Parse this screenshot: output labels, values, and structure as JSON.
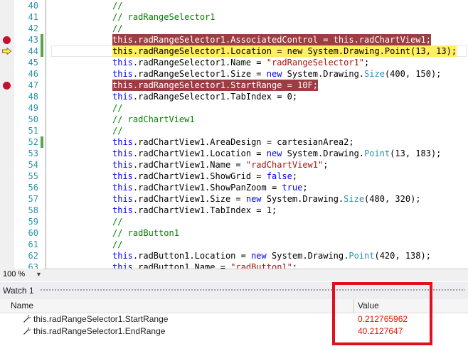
{
  "editor": {
    "lines": [
      {
        "num": "40",
        "bp": false,
        "arrow": false,
        "chg": false,
        "hl": "",
        "tokens": [
          {
            "t": "//",
            "c": "cmt"
          }
        ]
      },
      {
        "num": "41",
        "bp": false,
        "arrow": false,
        "chg": false,
        "hl": "",
        "tokens": [
          {
            "t": "// radRangeSelector1",
            "c": "cmt"
          }
        ]
      },
      {
        "num": "42",
        "bp": false,
        "arrow": false,
        "chg": false,
        "hl": "",
        "tokens": [
          {
            "t": "//",
            "c": "cmt"
          }
        ]
      },
      {
        "num": "43",
        "bp": true,
        "arrow": false,
        "chg": true,
        "hl": "red",
        "tokens": [
          {
            "t": "this.radRangeSelector1.AssociatedControl = this.radChartView1;",
            "c": ""
          }
        ]
      },
      {
        "num": "44",
        "bp": false,
        "arrow": true,
        "chg": true,
        "hl": "yellow",
        "tokens": [
          {
            "t": "this.radRangeSelector1.Location = new System.Drawing.Point(13, 13);",
            "c": ""
          }
        ]
      },
      {
        "num": "45",
        "bp": false,
        "arrow": false,
        "chg": false,
        "hl": "",
        "tokens": [
          {
            "t": "this",
            "c": "kw"
          },
          {
            "t": ".radRangeSelector1.Name = ",
            "c": ""
          },
          {
            "t": "\"radRangeSelector1\"",
            "c": "str"
          },
          {
            "t": ";",
            "c": ""
          }
        ]
      },
      {
        "num": "46",
        "bp": false,
        "arrow": false,
        "chg": false,
        "hl": "",
        "tokens": [
          {
            "t": "this",
            "c": "kw"
          },
          {
            "t": ".radRangeSelector1.Size = ",
            "c": ""
          },
          {
            "t": "new",
            "c": "kw"
          },
          {
            "t": " System.Drawing.",
            "c": ""
          },
          {
            "t": "Size",
            "c": "type"
          },
          {
            "t": "(400, 150);",
            "c": ""
          }
        ]
      },
      {
        "num": "47",
        "bp": true,
        "arrow": false,
        "chg": false,
        "hl": "red",
        "tokens": [
          {
            "t": "this.radRangeSelector1.StartRange = 10F;",
            "c": ""
          }
        ]
      },
      {
        "num": "48",
        "bp": false,
        "arrow": false,
        "chg": false,
        "hl": "",
        "tokens": [
          {
            "t": "this",
            "c": "kw"
          },
          {
            "t": ".radRangeSelector1.TabIndex = 0;",
            "c": ""
          }
        ]
      },
      {
        "num": "49",
        "bp": false,
        "arrow": false,
        "chg": false,
        "hl": "",
        "tokens": [
          {
            "t": "//",
            "c": "cmt"
          }
        ]
      },
      {
        "num": "50",
        "bp": false,
        "arrow": false,
        "chg": false,
        "hl": "",
        "tokens": [
          {
            "t": "// radChartView1",
            "c": "cmt"
          }
        ]
      },
      {
        "num": "51",
        "bp": false,
        "arrow": false,
        "chg": false,
        "hl": "",
        "tokens": [
          {
            "t": "//",
            "c": "cmt"
          }
        ]
      },
      {
        "num": "52",
        "bp": false,
        "arrow": false,
        "chg": true,
        "hl": "",
        "tokens": [
          {
            "t": "this",
            "c": "kw"
          },
          {
            "t": ".radChartView1.AreaDesign = cartesianArea2;",
            "c": ""
          }
        ]
      },
      {
        "num": "53",
        "bp": false,
        "arrow": false,
        "chg": false,
        "hl": "",
        "tokens": [
          {
            "t": "this",
            "c": "kw"
          },
          {
            "t": ".radChartView1.Location = ",
            "c": ""
          },
          {
            "t": "new",
            "c": "kw"
          },
          {
            "t": " System.Drawing.",
            "c": ""
          },
          {
            "t": "Point",
            "c": "type"
          },
          {
            "t": "(13, 183);",
            "c": ""
          }
        ]
      },
      {
        "num": "54",
        "bp": false,
        "arrow": false,
        "chg": false,
        "hl": "",
        "tokens": [
          {
            "t": "this",
            "c": "kw"
          },
          {
            "t": ".radChartView1.Name = ",
            "c": ""
          },
          {
            "t": "\"radChartView1\"",
            "c": "str"
          },
          {
            "t": ";",
            "c": ""
          }
        ]
      },
      {
        "num": "55",
        "bp": false,
        "arrow": false,
        "chg": false,
        "hl": "",
        "tokens": [
          {
            "t": "this",
            "c": "kw"
          },
          {
            "t": ".radChartView1.ShowGrid = ",
            "c": ""
          },
          {
            "t": "false",
            "c": "kw"
          },
          {
            "t": ";",
            "c": ""
          }
        ]
      },
      {
        "num": "56",
        "bp": false,
        "arrow": false,
        "chg": false,
        "hl": "",
        "tokens": [
          {
            "t": "this",
            "c": "kw"
          },
          {
            "t": ".radChartView1.ShowPanZoom = ",
            "c": ""
          },
          {
            "t": "true",
            "c": "kw"
          },
          {
            "t": ";",
            "c": ""
          }
        ]
      },
      {
        "num": "57",
        "bp": false,
        "arrow": false,
        "chg": false,
        "hl": "",
        "tokens": [
          {
            "t": "this",
            "c": "kw"
          },
          {
            "t": ".radChartView1.Size = ",
            "c": ""
          },
          {
            "t": "new",
            "c": "kw"
          },
          {
            "t": " System.Drawing.",
            "c": ""
          },
          {
            "t": "Size",
            "c": "type"
          },
          {
            "t": "(480, 320);",
            "c": ""
          }
        ]
      },
      {
        "num": "58",
        "bp": false,
        "arrow": false,
        "chg": false,
        "hl": "",
        "tokens": [
          {
            "t": "this",
            "c": "kw"
          },
          {
            "t": ".radChartView1.TabIndex = 1;",
            "c": ""
          }
        ]
      },
      {
        "num": "59",
        "bp": false,
        "arrow": false,
        "chg": false,
        "hl": "",
        "tokens": [
          {
            "t": "//",
            "c": "cmt"
          }
        ]
      },
      {
        "num": "60",
        "bp": false,
        "arrow": false,
        "chg": false,
        "hl": "",
        "tokens": [
          {
            "t": "// radButton1",
            "c": "cmt"
          }
        ]
      },
      {
        "num": "61",
        "bp": false,
        "arrow": false,
        "chg": false,
        "hl": "",
        "tokens": [
          {
            "t": "//",
            "c": "cmt"
          }
        ]
      },
      {
        "num": "62",
        "bp": false,
        "arrow": false,
        "chg": false,
        "hl": "",
        "tokens": [
          {
            "t": "this",
            "c": "kw"
          },
          {
            "t": ".radButton1.Location = ",
            "c": ""
          },
          {
            "t": "new",
            "c": "kw"
          },
          {
            "t": " System.Drawing.",
            "c": ""
          },
          {
            "t": "Point",
            "c": "type"
          },
          {
            "t": "(420, 138);",
            "c": ""
          }
        ]
      },
      {
        "num": "63",
        "bp": false,
        "arrow": false,
        "chg": false,
        "hl": "",
        "tokens": [
          {
            "t": "this",
            "c": "kw"
          },
          {
            "t": ".radButton1.Name = ",
            "c": ""
          },
          {
            "t": "\"radButton1\"",
            "c": "str"
          },
          {
            "t": ";",
            "c": ""
          }
        ]
      }
    ],
    "icons": {
      "breakpoint": "breakpoint-icon",
      "current": "current-statement-arrow-icon"
    }
  },
  "statusbar": {
    "zoom": "100 %"
  },
  "watch": {
    "title": "Watch 1",
    "col_name": "Name",
    "col_value": "Value",
    "rows": [
      {
        "name": "this.radRangeSelector1.StartRange",
        "value": "0.212765962"
      },
      {
        "name": "this.radRangeSelector1.EndRange",
        "value": "40.2127647"
      }
    ]
  },
  "colors": {
    "breakpoint": "#c8102e",
    "highlight_red": "#9b3e44",
    "highlight_yellow": "#ffee62",
    "value_red": "#e51400",
    "annotation_box": "#e0101e"
  }
}
